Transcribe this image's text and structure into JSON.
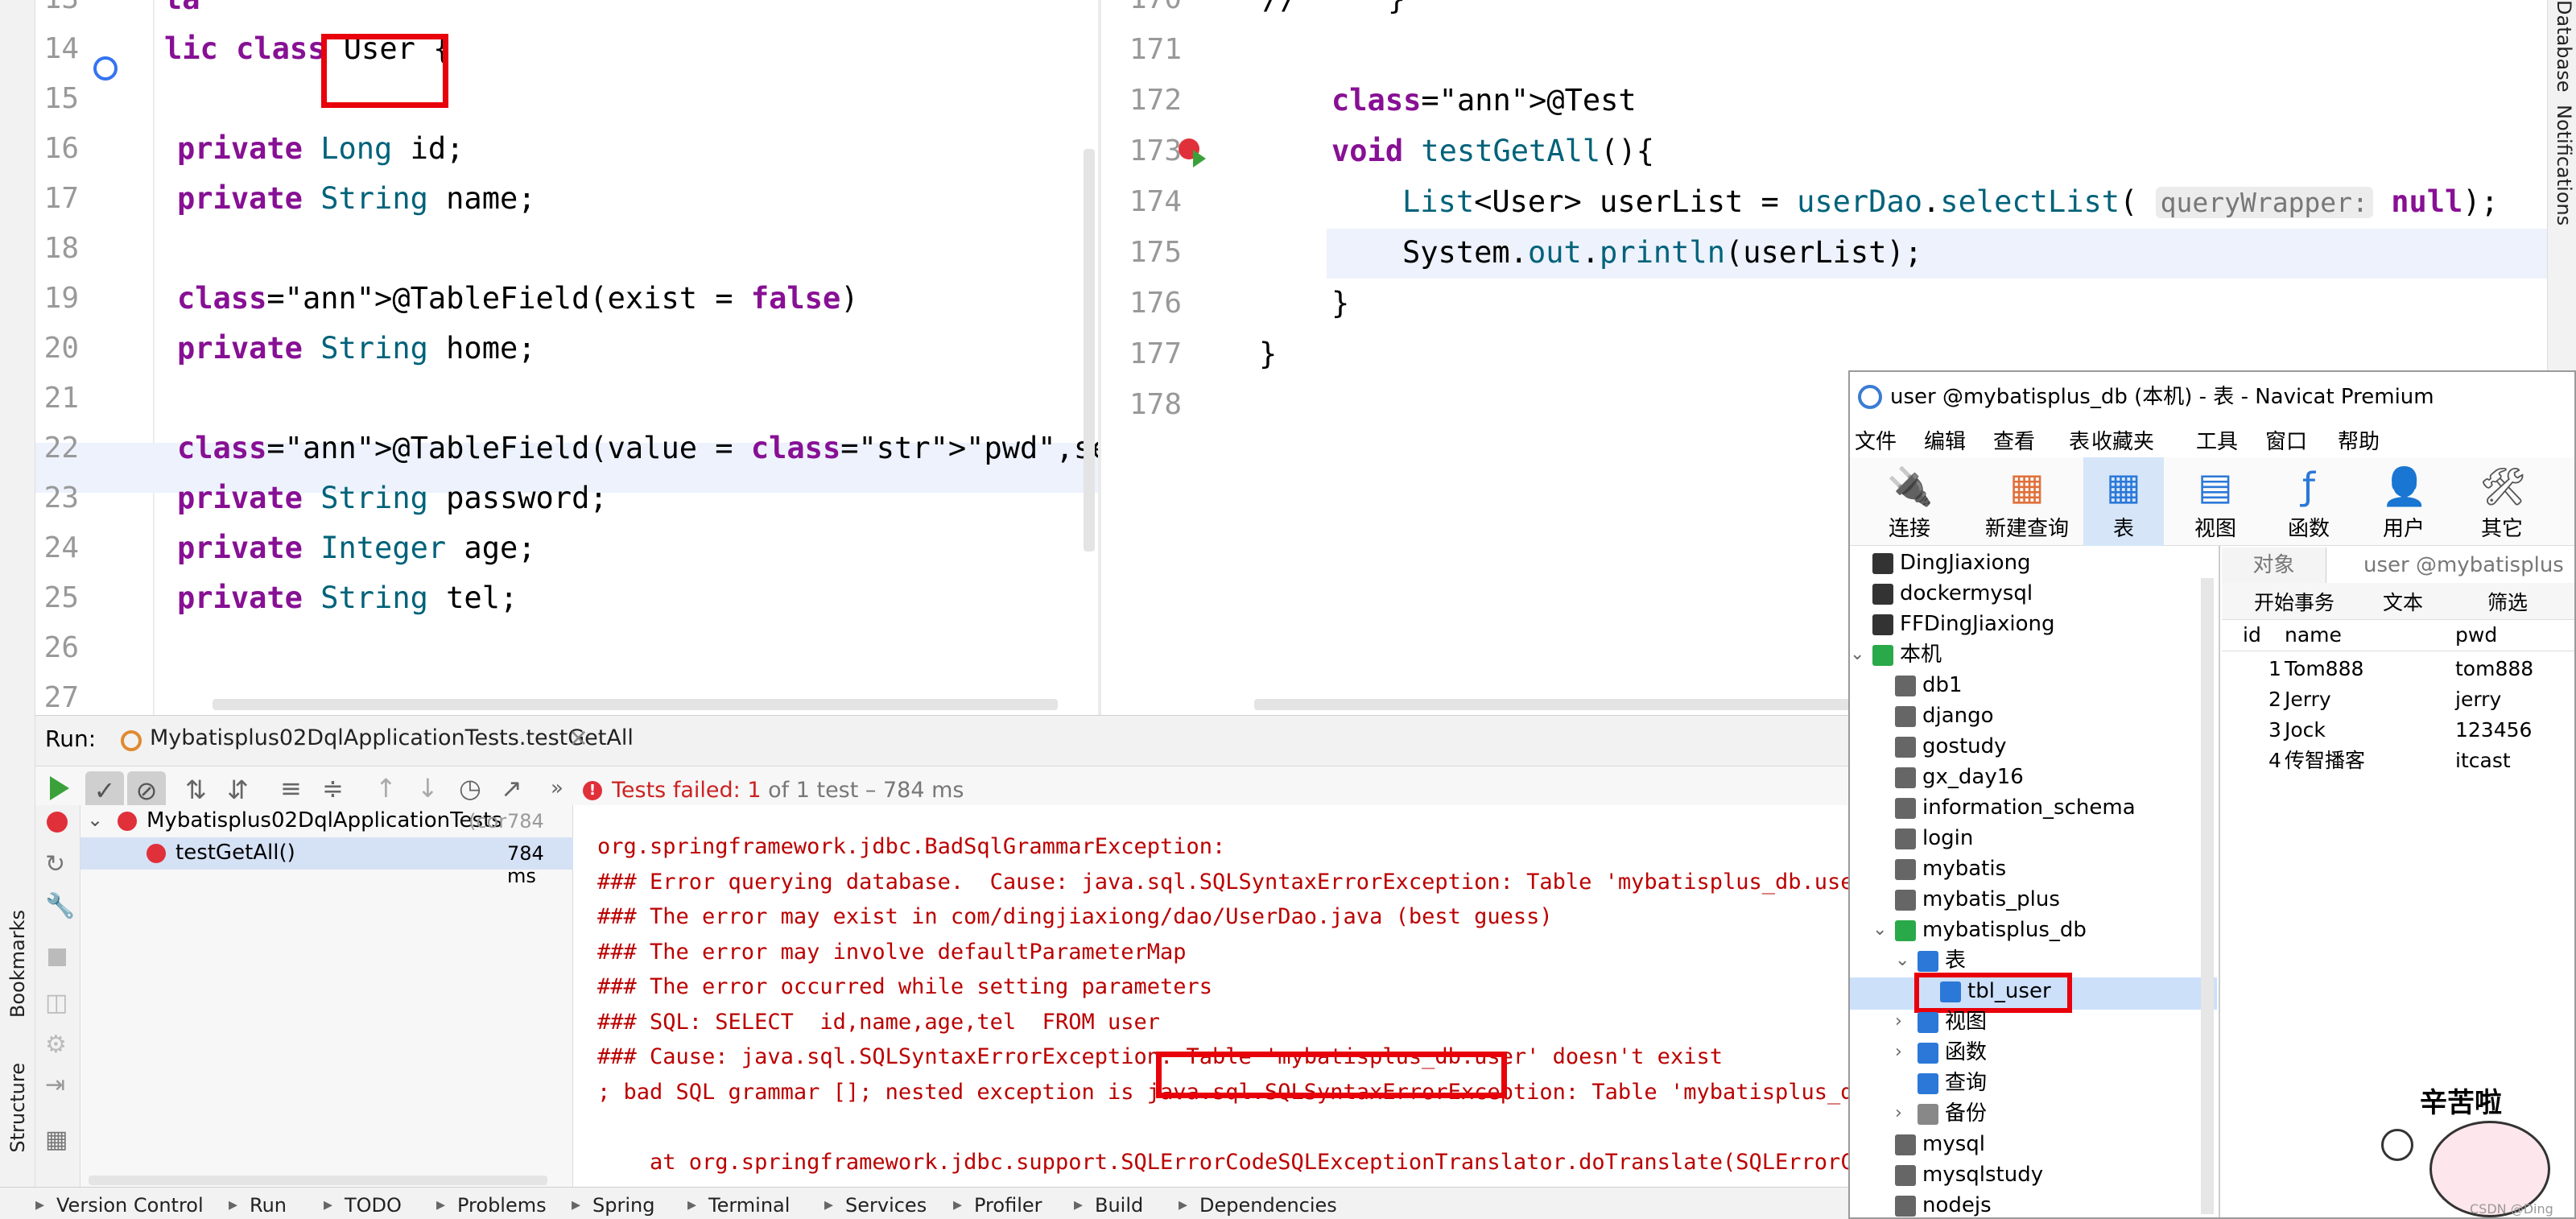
{
  "left_editor": {
    "lines": [
      {
        "n": "13",
        "code": "ta"
      },
      {
        "n": "14",
        "code": "lic class User {"
      },
      {
        "n": "15",
        "code": ""
      },
      {
        "n": "16",
        "code": "private Long id;"
      },
      {
        "n": "17",
        "code": "private String name;"
      },
      {
        "n": "18",
        "code": ""
      },
      {
        "n": "19",
        "code": "@TableField(exist = false)"
      },
      {
        "n": "20",
        "code": "private String home;"
      },
      {
        "n": "21",
        "code": ""
      },
      {
        "n": "22",
        "code": "@TableField(value = \"pwd\",select = false)"
      },
      {
        "n": "23",
        "code": "private String password;"
      },
      {
        "n": "24",
        "code": "private Integer age;"
      },
      {
        "n": "25",
        "code": "private String tel;"
      },
      {
        "n": "26",
        "code": ""
      },
      {
        "n": "27",
        "code": ""
      }
    ]
  },
  "right_editor": {
    "lines": [
      {
        "n": "170",
        "code": "//     }"
      },
      {
        "n": "171",
        "code": ""
      },
      {
        "n": "172",
        "code": "@Test"
      },
      {
        "n": "173",
        "code": "void testGetAll(){"
      },
      {
        "n": "174",
        "code": "List<User> userList = userDao.selectList( queryWrapper: null);"
      },
      {
        "n": "175",
        "code": "System.out.println(userList);"
      },
      {
        "n": "176",
        "code": "}"
      },
      {
        "n": "177",
        "code": "}"
      },
      {
        "n": "178",
        "code": ""
      }
    ],
    "hint": "queryWrapper:"
  },
  "run": {
    "label": "Run:",
    "tab": "Mybatisplus02DqlApplicationTests.testGetAll",
    "status_prefix": "Tests failed:",
    "status_count": "1",
    "status_suffix": "of 1 test – 784 ms",
    "tree": [
      {
        "label": "Mybatisplus02DqlApplicationTests",
        "suffix": "(cor",
        "time": "784 ms"
      },
      {
        "label": "testGetAll()",
        "time": "784 ms"
      }
    ],
    "console": [
      "org.springframework.jdbc.BadSqlGrammarException:",
      "### Error querying database.  Cause: java.sql.SQLSyntaxErrorException: Table 'mybatisplus_db.user'",
      "### The error may exist in com/dingjiaxiong/dao/UserDao.java (best guess)",
      "### The error may involve defaultParameterMap",
      "### The error occurred while setting parameters",
      "### SQL: SELECT  id,name,age,tel  FROM user",
      "### Cause: java.sql.SQLSyntaxErrorException: Table 'mybatisplus_db.user' doesn't exist",
      "; bad SQL grammar []; nested exception is java.sql.SQLSyntaxErrorException: Table 'mybatisplus_db.",
      "",
      "    at org.springframework.jdbc.support.SQLErrorCodeSQLExceptionTranslator.doTranslate(SQLErrorCod"
    ]
  },
  "statusbar": [
    "Version Control",
    "Run",
    "TODO",
    "Problems",
    "Spring",
    "Terminal",
    "Services",
    "Profiler",
    "Build",
    "Dependencies"
  ],
  "side_left": [
    "Bookmarks",
    "Structure"
  ],
  "side_right": [
    "Database",
    "Notifications"
  ],
  "navicat": {
    "title": "user @mybatisplus_db (本机) - 表 - Navicat Premium",
    "menu": [
      "文件",
      "编辑",
      "查看",
      "表",
      "收藏夹",
      "工具",
      "窗口",
      "帮助"
    ],
    "tools": [
      "连接",
      "新建查询",
      "表",
      "视图",
      "函数",
      "用户",
      "其它"
    ],
    "connections": [
      "DingJiaxiong",
      "dockermysql",
      "FFDingJiaxiong",
      "本机"
    ],
    "databases": [
      "db1",
      "django",
      "gostudy",
      "gx_day16",
      "information_schema",
      "login",
      "mybatis",
      "mybatis_plus",
      "mybatisplus_db"
    ],
    "sub": [
      "表",
      "tbl_user",
      "视图",
      "函数",
      "查询",
      "备份"
    ],
    "more_dbs": [
      "mysql",
      "mysqlstudy",
      "nodejs"
    ],
    "tabs": [
      "对象",
      "user @mybatisplus"
    ],
    "subtools": [
      "开始事务",
      "文本",
      "筛选"
    ],
    "columns": [
      "id",
      "name",
      "pwd"
    ],
    "rows": [
      {
        "id": "1",
        "name": "Tom888",
        "pwd": "tom888"
      },
      {
        "id": "2",
        "name": "Jerry",
        "pwd": "jerry"
      },
      {
        "id": "3",
        "name": "Jock",
        "pwd": "123456"
      },
      {
        "id": "4",
        "name": "传智播客",
        "pwd": "itcast"
      }
    ],
    "sticker_text": "辛苦啦",
    "watermark": "CSDN @Ding Jiaxiong"
  }
}
